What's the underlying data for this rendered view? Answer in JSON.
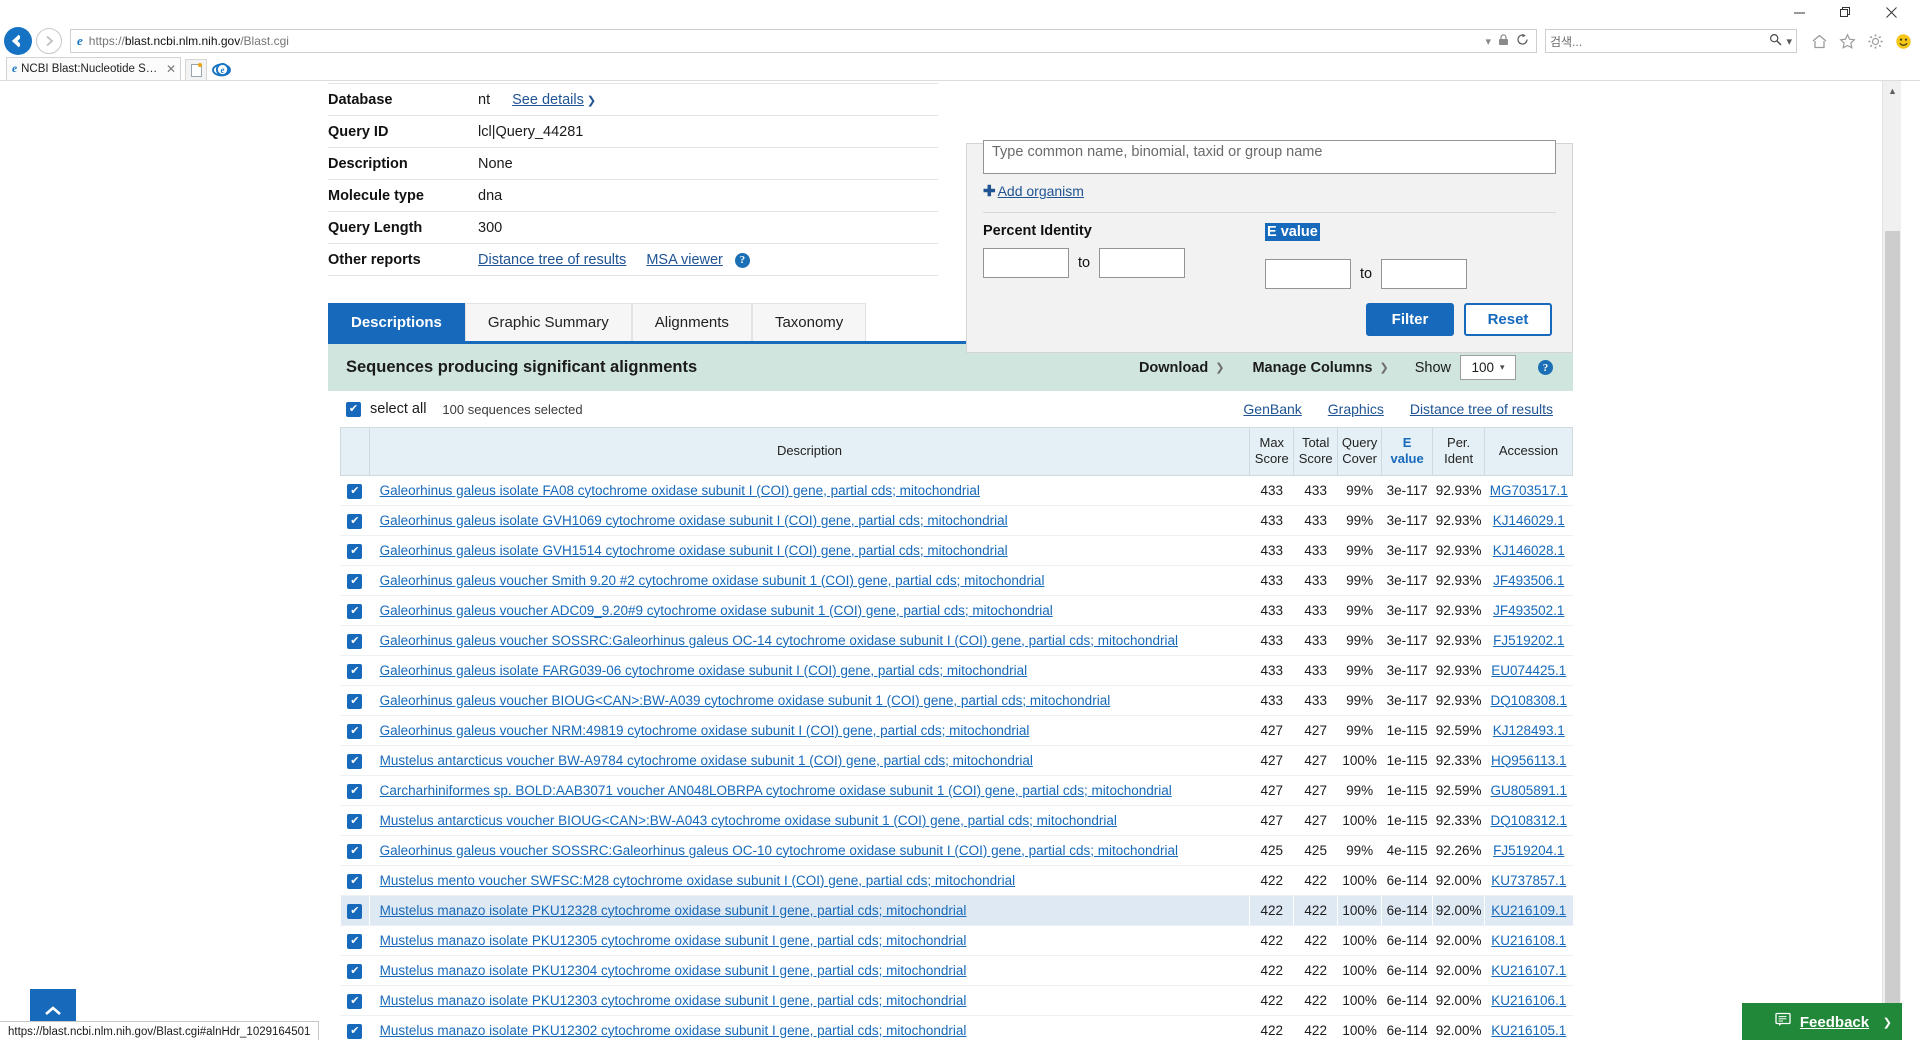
{
  "browser": {
    "window_controls": {
      "minimize": "—",
      "restore": "❐",
      "close": "✕"
    },
    "nav": {
      "back_icon": "back-arrow",
      "forward_icon": "forward-arrow"
    },
    "address": {
      "scheme": "https://",
      "host": "blast.ncbi.nlm.nih.gov",
      "path": "/Blast.cgi",
      "full_url": "https://blast.ncbi.nlm.nih.gov/Blast.cgi",
      "dropdown_icon": "chevron-down-icon",
      "lock_icon": "lock-icon",
      "refresh_icon": "refresh-icon"
    },
    "search": {
      "placeholder": "검색...",
      "icon": "search-icon",
      "dropdown_icon": "chevron-down-icon"
    },
    "toolbar_icons": [
      "home-icon",
      "favorites-star-icon",
      "gear-icon",
      "smiley-face-icon"
    ],
    "tab": {
      "title": "NCBI Blast:Nucleotide Seq...",
      "close": "✕",
      "favicon": "ie-blast-icon"
    },
    "new_tab_icon": "new-tab-icon",
    "ie_icon": "internet-explorer-icon"
  },
  "query_info": {
    "rows": [
      {
        "label": "Database",
        "value": "nt",
        "link": "See details",
        "has_caret": true
      },
      {
        "label": "Query ID",
        "value": "lcl|Query_44281"
      },
      {
        "label": "Description",
        "value": "None"
      },
      {
        "label": "Molecule type",
        "value": "dna"
      },
      {
        "label": "Query Length",
        "value": "300"
      }
    ],
    "other_reports": {
      "label": "Other reports",
      "links": [
        "Distance tree of results",
        "MSA viewer"
      ],
      "help_icon": "question-mark-icon"
    }
  },
  "filter_panel": {
    "organism_placeholder": "Type common name, binomial, taxid or group name",
    "add_organism": "Add organism",
    "percent_identity": {
      "label": "Percent Identity",
      "from": "",
      "to_label": "to",
      "to": ""
    },
    "e_value": {
      "label": "E value",
      "selected": true,
      "from": "",
      "to_label": "to",
      "to": ""
    },
    "filter_button": "Filter",
    "reset_button": "Reset"
  },
  "result_tabs": [
    {
      "label": "Descriptions",
      "active": true
    },
    {
      "label": "Graphic Summary",
      "active": false
    },
    {
      "label": "Alignments",
      "active": false
    },
    {
      "label": "Taxonomy",
      "active": false
    }
  ],
  "results_header": {
    "title": "Sequences producing significant alignments",
    "download": "Download",
    "manage_columns": "Manage Columns",
    "show_label": "Show",
    "show_value": "100",
    "help_icon": "question-mark-icon"
  },
  "select_row": {
    "select_all": "select all",
    "count_text": "100 sequences selected",
    "links": [
      "GenBank",
      "Graphics",
      "Distance tree of results"
    ]
  },
  "table": {
    "headers": {
      "description": "Description",
      "max_score": [
        "Max",
        "Score"
      ],
      "total_score": [
        "Total",
        "Score"
      ],
      "query_cover": [
        "Query",
        "Cover"
      ],
      "e_value": [
        "E",
        "value"
      ],
      "per_ident": [
        "Per.",
        "Ident"
      ],
      "accession": "Accession"
    },
    "rows": [
      {
        "checked": true,
        "description": "Galeorhinus galeus isolate FA08 cytochrome oxidase subunit I (COI) gene, partial cds; mitochondrial",
        "max_score": "433",
        "total_score": "433",
        "query_cover": "99%",
        "e_value": "3e-117",
        "per_ident": "92.93%",
        "accession": "MG703517.1",
        "highlighted": false
      },
      {
        "checked": true,
        "description": "Galeorhinus galeus isolate GVH1069 cytochrome oxidase subunit I (COI) gene, partial cds; mitochondrial",
        "max_score": "433",
        "total_score": "433",
        "query_cover": "99%",
        "e_value": "3e-117",
        "per_ident": "92.93%",
        "accession": "KJ146029.1",
        "highlighted": false
      },
      {
        "checked": true,
        "description": "Galeorhinus galeus isolate GVH1514 cytochrome oxidase subunit I (COI) gene, partial cds; mitochondrial",
        "max_score": "433",
        "total_score": "433",
        "query_cover": "99%",
        "e_value": "3e-117",
        "per_ident": "92.93%",
        "accession": "KJ146028.1",
        "highlighted": false
      },
      {
        "checked": true,
        "description": "Galeorhinus galeus voucher Smith 9.20 #2 cytochrome oxidase subunit 1 (COI) gene, partial cds; mitochondrial",
        "max_score": "433",
        "total_score": "433",
        "query_cover": "99%",
        "e_value": "3e-117",
        "per_ident": "92.93%",
        "accession": "JF493506.1",
        "highlighted": false
      },
      {
        "checked": true,
        "description": "Galeorhinus galeus voucher ADC09_9.20#9 cytochrome oxidase subunit 1 (COI) gene, partial cds; mitochondrial",
        "max_score": "433",
        "total_score": "433",
        "query_cover": "99%",
        "e_value": "3e-117",
        "per_ident": "92.93%",
        "accession": "JF493502.1",
        "highlighted": false
      },
      {
        "checked": true,
        "description": "Galeorhinus galeus voucher SOSSRC:Galeorhinus galeus OC-14 cytochrome oxidase subunit I (COI) gene, partial cds; mitochondrial",
        "max_score": "433",
        "total_score": "433",
        "query_cover": "99%",
        "e_value": "3e-117",
        "per_ident": "92.93%",
        "accession": "FJ519202.1",
        "highlighted": false
      },
      {
        "checked": true,
        "description": "Galeorhinus galeus isolate FARG039-06 cytochrome oxidase subunit I (COI) gene, partial cds; mitochondrial",
        "max_score": "433",
        "total_score": "433",
        "query_cover": "99%",
        "e_value": "3e-117",
        "per_ident": "92.93%",
        "accession": "EU074425.1",
        "highlighted": false
      },
      {
        "checked": true,
        "description": "Galeorhinus galeus voucher BIOUG<CAN>:BW-A039 cytochrome oxidase subunit 1 (COI) gene, partial cds; mitochondrial",
        "max_score": "433",
        "total_score": "433",
        "query_cover": "99%",
        "e_value": "3e-117",
        "per_ident": "92.93%",
        "accession": "DQ108308.1",
        "highlighted": false
      },
      {
        "checked": true,
        "description": "Galeorhinus galeus voucher NRM:49819 cytochrome oxidase subunit I (COI) gene, partial cds; mitochondrial",
        "max_score": "427",
        "total_score": "427",
        "query_cover": "99%",
        "e_value": "1e-115",
        "per_ident": "92.59%",
        "accession": "KJ128493.1",
        "highlighted": false
      },
      {
        "checked": true,
        "description": "Mustelus antarcticus voucher BW-A9784 cytochrome oxidase subunit 1 (COI) gene, partial cds; mitochondrial",
        "max_score": "427",
        "total_score": "427",
        "query_cover": "100%",
        "e_value": "1e-115",
        "per_ident": "92.33%",
        "accession": "HQ956113.1",
        "highlighted": false
      },
      {
        "checked": true,
        "description": "Carcharhiniformes sp. BOLD:AAB3071 voucher AN048LOBRPA cytochrome oxidase subunit 1 (COI) gene, partial cds; mitochondrial",
        "max_score": "427",
        "total_score": "427",
        "query_cover": "99%",
        "e_value": "1e-115",
        "per_ident": "92.59%",
        "accession": "GU805891.1",
        "highlighted": false
      },
      {
        "checked": true,
        "description": "Mustelus antarcticus voucher BIOUG<CAN>:BW-A043 cytochrome oxidase subunit 1 (COI) gene, partial cds; mitochondrial",
        "max_score": "427",
        "total_score": "427",
        "query_cover": "100%",
        "e_value": "1e-115",
        "per_ident": "92.33%",
        "accession": "DQ108312.1",
        "highlighted": false
      },
      {
        "checked": true,
        "description": "Galeorhinus galeus voucher SOSSRC:Galeorhinus galeus OC-10 cytochrome oxidase subunit I (COI) gene, partial cds; mitochondrial",
        "max_score": "425",
        "total_score": "425",
        "query_cover": "99%",
        "e_value": "4e-115",
        "per_ident": "92.26%",
        "accession": "FJ519204.1",
        "highlighted": false
      },
      {
        "checked": true,
        "description": "Mustelus mento voucher SWFSC:M28 cytochrome oxidase subunit I (COI) gene, partial cds; mitochondrial",
        "max_score": "422",
        "total_score": "422",
        "query_cover": "100%",
        "e_value": "6e-114",
        "per_ident": "92.00%",
        "accession": "KU737857.1",
        "highlighted": false
      },
      {
        "checked": true,
        "description": "Mustelus manazo isolate PKU12328 cytochrome oxidase subunit I gene, partial cds; mitochondrial",
        "max_score": "422",
        "total_score": "422",
        "query_cover": "100%",
        "e_value": "6e-114",
        "per_ident": "92.00%",
        "accession": "KU216109.1",
        "highlighted": true
      },
      {
        "checked": true,
        "description": "Mustelus manazo isolate PKU12305 cytochrome oxidase subunit I gene, partial cds; mitochondrial",
        "max_score": "422",
        "total_score": "422",
        "query_cover": "100%",
        "e_value": "6e-114",
        "per_ident": "92.00%",
        "accession": "KU216108.1",
        "highlighted": false
      },
      {
        "checked": true,
        "description": "Mustelus manazo isolate PKU12304 cytochrome oxidase subunit I gene, partial cds; mitochondrial",
        "max_score": "422",
        "total_score": "422",
        "query_cover": "100%",
        "e_value": "6e-114",
        "per_ident": "92.00%",
        "accession": "KU216107.1",
        "highlighted": false
      },
      {
        "checked": true,
        "description": "Mustelus manazo isolate PKU12303 cytochrome oxidase subunit I gene, partial cds; mitochondrial",
        "max_score": "422",
        "total_score": "422",
        "query_cover": "100%",
        "e_value": "6e-114",
        "per_ident": "92.00%",
        "accession": "KU216106.1",
        "highlighted": false
      },
      {
        "checked": true,
        "description": "Mustelus manazo isolate PKU12302 cytochrome oxidase subunit I gene, partial cds; mitochondrial",
        "max_score": "422",
        "total_score": "422",
        "query_cover": "100%",
        "e_value": "6e-114",
        "per_ident": "92.00%",
        "accession": "KU216105.1",
        "highlighted": false
      }
    ]
  },
  "back_to_top": {
    "icon": "chevron-up-icon"
  },
  "feedback": {
    "label": "Feedback",
    "icon": "speech-bubble-icon",
    "caret": "chevron-down-icon"
  },
  "status_bar": {
    "url": "https://blast.ncbi.nlm.nih.gov/Blast.cgi#alnHdr_1029164501"
  },
  "colors": {
    "accent_blue": "#1669bb",
    "band_green": "#cfe5de",
    "feedback_green": "#218739",
    "header_blue": "#e5f0f6",
    "highlight_row": "#dfe9f3"
  }
}
